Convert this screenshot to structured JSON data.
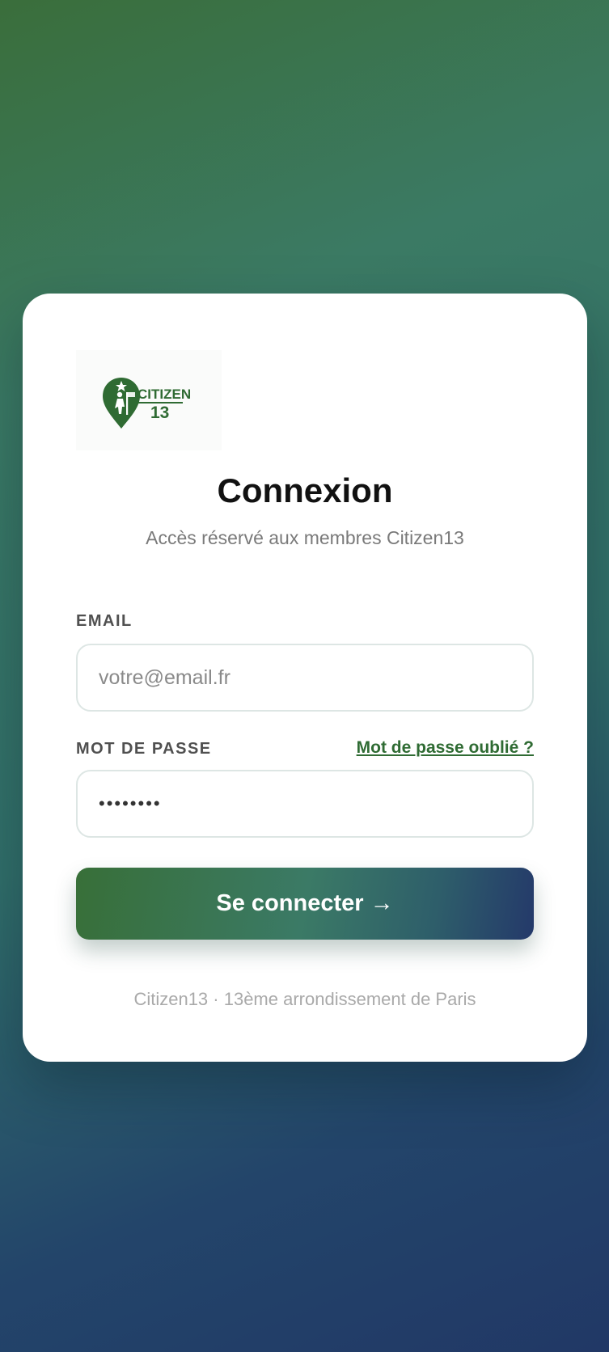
{
  "brand": {
    "logo_text_top": "CITIZEN",
    "logo_text_bottom": "13",
    "color": "#2f6b33"
  },
  "login": {
    "title": "Connexion",
    "subtitle": "Accès réservé aux membres Citizen13",
    "email_label": "EMAIL",
    "email_placeholder": "votre@email.fr",
    "password_label": "MOT DE PASSE",
    "forgot_link": "Mot de passe oublié ?",
    "password_masked": "••••••••",
    "submit_label": "Se connecter →",
    "footer": "Citizen13 · 13ème arrondissement de Paris"
  },
  "colors": {
    "accent_green": "#2f6b33",
    "gradient_start": "#386f38",
    "gradient_end": "#24396a"
  }
}
